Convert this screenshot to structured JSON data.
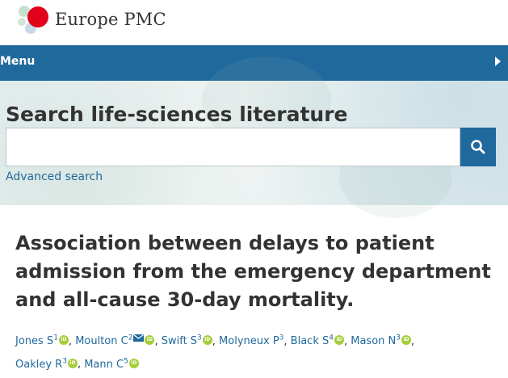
{
  "header": {
    "brand": "Europe PMC"
  },
  "menu": {
    "label": "Menu"
  },
  "search": {
    "title": "Search life-sciences literature",
    "value": "",
    "placeholder": "",
    "advanced_label": "Advanced search"
  },
  "article": {
    "title": "Association between delays to patient admission from the emergency department and all-cause 30-day mortality.",
    "authors": [
      {
        "name": "Jones S",
        "sup": "1",
        "orcid": true,
        "email": false
      },
      {
        "name": "Moulton C",
        "sup": "2",
        "orcid": true,
        "email": true
      },
      {
        "name": "Swift S",
        "sup": "3",
        "orcid": true,
        "email": false
      },
      {
        "name": "Molyneux P",
        "sup": "3",
        "orcid": false,
        "email": false
      },
      {
        "name": "Black S",
        "sup": "4",
        "orcid": true,
        "email": false
      },
      {
        "name": "Mason N",
        "sup": "3",
        "orcid": true,
        "email": false
      },
      {
        "name": "Oakley R",
        "sup": "3",
        "orcid": true,
        "email": false
      },
      {
        "name": "Mann C",
        "sup": "5",
        "orcid": true,
        "email": false
      }
    ],
    "orcid_badge": "iD"
  },
  "colors": {
    "brand_blue": "#20699c",
    "orcid_green": "#a6ce39",
    "logo_red": "#e2001a"
  },
  "icons": {
    "logo": "europe-pmc-logo-icon",
    "menu_arrow": "chevron-right-icon",
    "search": "search-icon",
    "orcid": "orcid-icon",
    "email": "email-icon"
  }
}
